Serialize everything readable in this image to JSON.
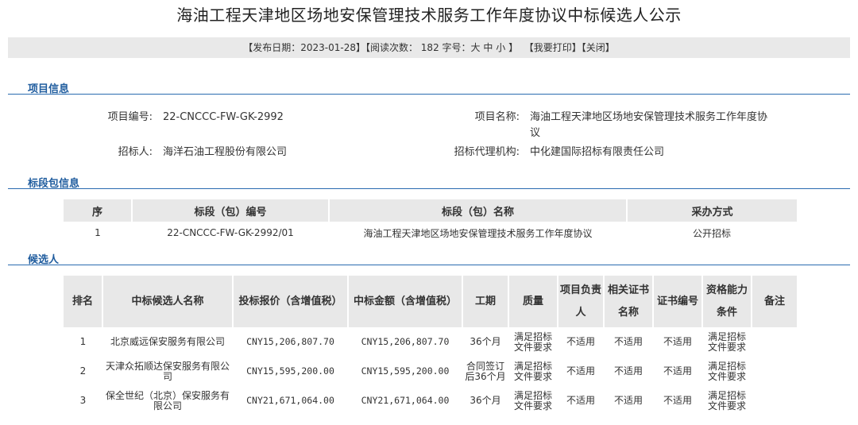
{
  "title": "海油工程天津地区场地安保管理技术服务工作年度协议中标候选人公示",
  "info_bar": {
    "publish_date": "【发布日期：2023-01-28】",
    "read_count": "【阅读次数： 182 ",
    "font_size_label": "字号：",
    "font_large": "大",
    "font_medium": "中",
    "font_small": "小",
    "bracket_close": " 】",
    "print": "【我要打印】",
    "close": "【关闭】"
  },
  "sections": {
    "project": "项目信息",
    "package": "标段包信息",
    "candidate": "候选人"
  },
  "project_info": {
    "number_label": "项目编号:",
    "number": "22-CNCCC-FW-GK-2992",
    "name_label": "项目名称:",
    "name": "海油工程天津地区场地安保管理技术服务工作年度协议",
    "tenderer_label": "招标人:",
    "tenderer": "海洋石油工程股份有限公司",
    "agency_label": "招标代理机构:",
    "agency": "中化建国际招标有限责任公司"
  },
  "package_table": {
    "headers": [
      "序",
      "标段（包）编号",
      "标段（包）名称",
      "采办方式"
    ],
    "rows": [
      [
        "1",
        "22-CNCCC-FW-GK-2992/01",
        "海油工程天津地区场地安保管理技术服务工作年度协议",
        "公开招标"
      ]
    ]
  },
  "candidate_table": {
    "headers": [
      "排名",
      "中标候选人名称",
      "投标报价（含增值税）",
      "中标金额（含增值税）",
      "工期",
      "质量",
      "项目负责人",
      "相关证书名称",
      "证书编号",
      "资格能力条件",
      "备注"
    ],
    "rows": [
      [
        "1",
        "北京威远保安服务有限公司",
        "CNY15,206,807.70",
        "CNY15,206,807.70",
        "36个月",
        "满足招标文件要求",
        "不适用",
        "不适用",
        "不适用",
        "满足招标文件要求",
        ""
      ],
      [
        "2",
        "天津众拓顺达保安服务有限公司",
        "CNY15,595,200.00",
        "CNY15,595,200.00",
        "合同签订后36个月",
        "满足招标文件要求",
        "不适用",
        "不适用",
        "不适用",
        "满足招标文件要求",
        ""
      ],
      [
        "3",
        "保全世纪（北京）保安服务有限公司",
        "CNY21,671,064.00",
        "CNY21,671,064.00",
        "36个月",
        "满足招标文件要求",
        "不适用",
        "不适用",
        "不适用",
        "满足招标文件要求",
        ""
      ]
    ]
  }
}
